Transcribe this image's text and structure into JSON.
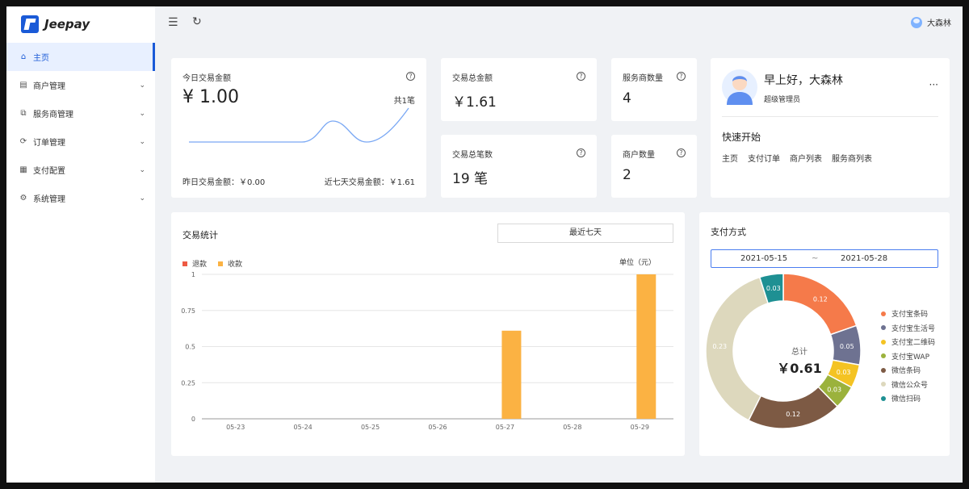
{
  "app": {
    "logo_text": "Jeepay"
  },
  "sidebar": {
    "items": [
      {
        "label": "主页",
        "icon": "home-icon",
        "glyph": "⌂",
        "active": true
      },
      {
        "label": "商户管理",
        "icon": "grid-icon",
        "glyph": "▤"
      },
      {
        "label": "服务商管理",
        "icon": "copy-icon",
        "glyph": "⧉"
      },
      {
        "label": "订单管理",
        "icon": "refresh-icon",
        "glyph": "⟳"
      },
      {
        "label": "支付配置",
        "icon": "document-icon",
        "glyph": "▦"
      },
      {
        "label": "系统管理",
        "icon": "settings-icon",
        "glyph": "⚙"
      }
    ]
  },
  "header": {
    "user_name": "大森林"
  },
  "today": {
    "label": "今日交易金额",
    "amount": "¥ 1.00",
    "count": "共1笔",
    "yesterday": "昨日交易金额：￥0.00",
    "seven_days": "近七天交易金额：￥1.61"
  },
  "stats": {
    "total_amount_label": "交易总金额",
    "total_amount": "￥1.61",
    "total_count_label": "交易总笔数",
    "total_count": "19 笔",
    "isv_label": "服务商数量",
    "isv_count": "4",
    "mch_label": "商户数量",
    "mch_count": "2"
  },
  "welcome": {
    "greeting": "早上好，大森林",
    "role": "超级管理员",
    "more": "···",
    "quick_title": "快速开始",
    "quick_links": [
      "主页",
      "支付订单",
      "商户列表",
      "服务商列表"
    ]
  },
  "trade_stats": {
    "title": "交易统计",
    "period": "最近七天",
    "unit": "单位（元）"
  },
  "pay_method": {
    "title": "支付方式",
    "start_date": "2021-05-15",
    "separator": "~",
    "end_date": "2021-05-28",
    "total_label": "总计",
    "total_value": "￥0.61"
  },
  "chart_data": [
    {
      "type": "bar",
      "legend_position": "top-left",
      "grid": true,
      "categories": [
        "05-23",
        "05-24",
        "05-25",
        "05-26",
        "05-27",
        "05-28",
        "05-29"
      ],
      "series": [
        {
          "name": "退款",
          "color": "#ee5a43",
          "values": [
            0,
            0,
            0,
            0,
            0,
            0,
            0
          ]
        },
        {
          "name": "收款",
          "color": "#fbb243",
          "values": [
            0,
            0,
            0,
            0,
            0.61,
            0,
            1
          ]
        }
      ],
      "yticks": [
        "0",
        "0.25",
        "0.5",
        "0.75",
        "1"
      ],
      "ylim": [
        0,
        1
      ]
    },
    {
      "type": "pie",
      "donut": true,
      "legend_position": "right",
      "slices": [
        {
          "name": "支付宝条码",
          "value": 0.12,
          "label": "0.12",
          "color": "#f57a4a"
        },
        {
          "name": "支付宝生活号",
          "value": 0.05,
          "label": "0.05",
          "color": "#6e7291"
        },
        {
          "name": "支付宝二维码",
          "value": 0.03,
          "label": "0.03",
          "color": "#f4c323"
        },
        {
          "name": "支付宝WAP",
          "value": 0.03,
          "label": "0.03",
          "color": "#9bb23c"
        },
        {
          "name": "微信条码",
          "value": 0.12,
          "label": "0.12",
          "color": "#7d5a44"
        },
        {
          "name": "微信公众号",
          "value": 0.23,
          "label": "0.23",
          "color": "#ddd8bd"
        },
        {
          "name": "微信扫码",
          "value": 0.03,
          "label": "0.03",
          "color": "#1e9093"
        }
      ]
    }
  ]
}
